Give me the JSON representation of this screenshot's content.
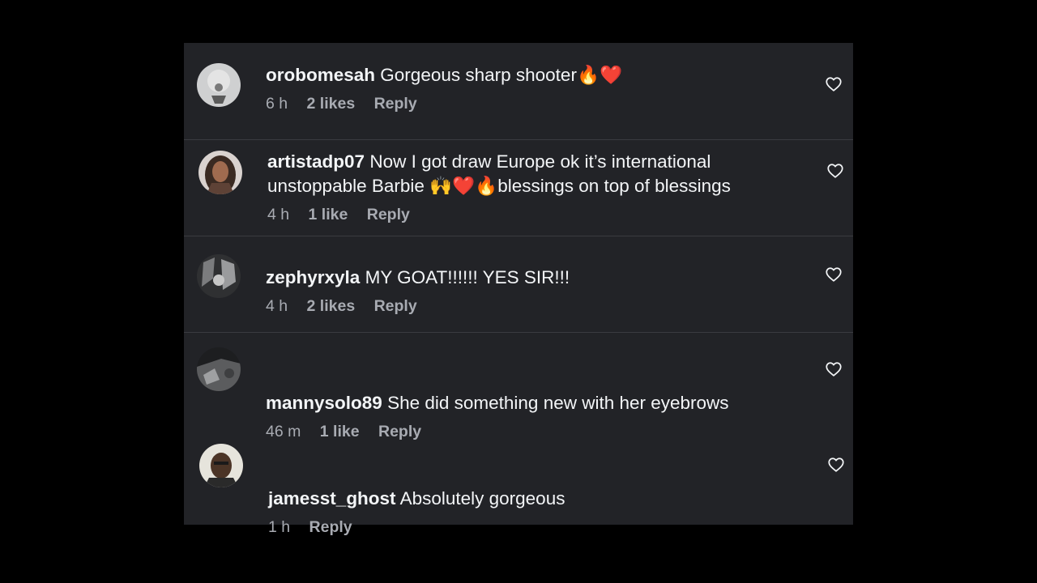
{
  "comments": [
    {
      "username": "orobomesah",
      "text": "Gorgeous sharp shooter🔥❤️",
      "time": "6 h",
      "likes": "2 likes",
      "reply": "Reply",
      "heart_icon": "heart-outline-icon"
    },
    {
      "username": "artistadp07",
      "text": "Now I got draw Europe ok it’s international unstoppable Barbie 🙌❤️🔥blessings on top of blessings",
      "time": "4 h",
      "likes": "1 like",
      "reply": "Reply",
      "heart_icon": "heart-outline-icon"
    },
    {
      "username": "zephyrxyla",
      "text": "MY GOAT!!!!!! YES SIR!!!",
      "time": "4 h",
      "likes": "2 likes",
      "reply": "Reply",
      "heart_icon": "heart-outline-icon"
    },
    {
      "username": "mannysolo89",
      "text": "She did something new with her eyebrows",
      "time": "46 m",
      "likes": "1 like",
      "reply": "Reply",
      "heart_icon": "heart-outline-icon"
    },
    {
      "username": "jamesst_ghost",
      "text": "Absolutely gorgeous",
      "time": "1 h",
      "reply": "Reply",
      "heart_icon": "heart-outline-icon"
    }
  ],
  "colors": {
    "panel_background": "#222327",
    "text_primary": "#f3f5f7",
    "text_secondary": "#a8abb2",
    "divider": "#3a3b40"
  }
}
